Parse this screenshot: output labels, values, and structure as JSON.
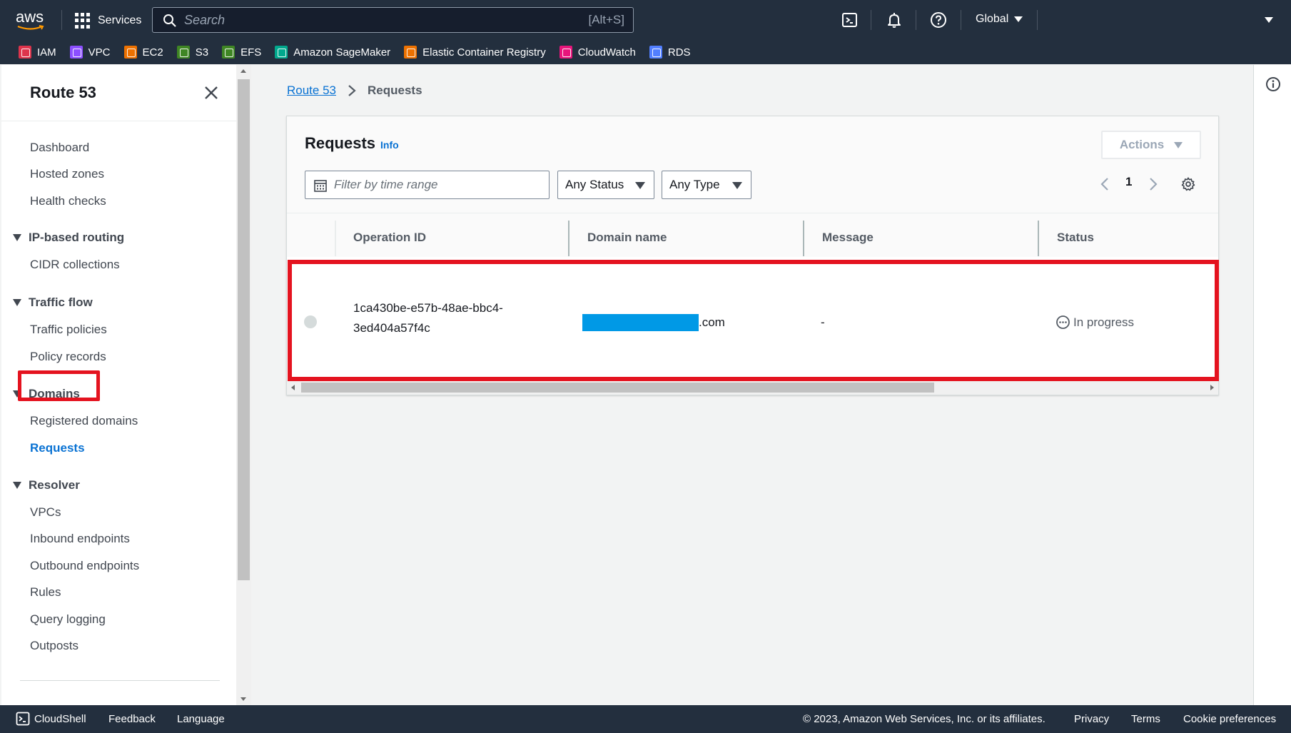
{
  "topnav": {
    "logo_text": "aws",
    "services_label": "Services",
    "search_placeholder": "Search",
    "search_shortcut": "[Alt+S]",
    "region_label": "Global",
    "icons": [
      "cloudshell-icon",
      "bell-icon",
      "help-icon"
    ]
  },
  "favorites": [
    {
      "label": "IAM",
      "color": "#dd344c"
    },
    {
      "label": "VPC",
      "color": "#8c4fff"
    },
    {
      "label": "EC2",
      "color": "#ed7100"
    },
    {
      "label": "S3",
      "color": "#3f8624"
    },
    {
      "label": "EFS",
      "color": "#3f8624"
    },
    {
      "label": "Amazon SageMaker",
      "color": "#01a88d"
    },
    {
      "label": "Elastic Container Registry",
      "color": "#ed7100"
    },
    {
      "label": "CloudWatch",
      "color": "#e7157b"
    },
    {
      "label": "RDS",
      "color": "#527fff"
    }
  ],
  "sidebar": {
    "title": "Route 53",
    "items": {
      "dashboard": "Dashboard",
      "hosted_zones": "Hosted zones",
      "health_checks": "Health checks",
      "ip_routing": "IP-based routing",
      "cidr": "CIDR collections",
      "traffic_flow": "Traffic flow",
      "traffic_policies": "Traffic policies",
      "policy_records": "Policy records",
      "domains": "Domains",
      "registered_domains": "Registered domains",
      "requests": "Requests",
      "resolver": "Resolver",
      "vpcs": "VPCs",
      "inbound": "Inbound endpoints",
      "outbound": "Outbound endpoints",
      "rules": "Rules",
      "query_logging": "Query logging",
      "outposts": "Outposts"
    }
  },
  "breadcrumb": {
    "root": "Route 53",
    "current": "Requests"
  },
  "panel": {
    "title": "Requests",
    "info": "Info",
    "actions_label": "Actions",
    "filter_placeholder": "Filter by time range",
    "status_select": "Any Status",
    "type_select": "Any Type",
    "page": "1"
  },
  "table": {
    "columns": [
      "Operation ID",
      "Domain name",
      "Message",
      "Status"
    ],
    "rows": [
      {
        "operation_id": "1ca430be-e57b-48ae-bbc4-3ed404a57f4c",
        "domain_suffix": ".com",
        "message": "-",
        "status": "In progress"
      }
    ]
  },
  "footer": {
    "cloudshell": "CloudShell",
    "feedback": "Feedback",
    "language": "Language",
    "copyright": "© 2023, Amazon Web Services, Inc. or its affiliates.",
    "privacy": "Privacy",
    "terms": "Terms",
    "cookie": "Cookie preferences"
  },
  "colors": {
    "nav_bg": "#232f3e",
    "link": "#0972d3",
    "highlight": "#e4131f",
    "redaction": "#0099e6"
  }
}
